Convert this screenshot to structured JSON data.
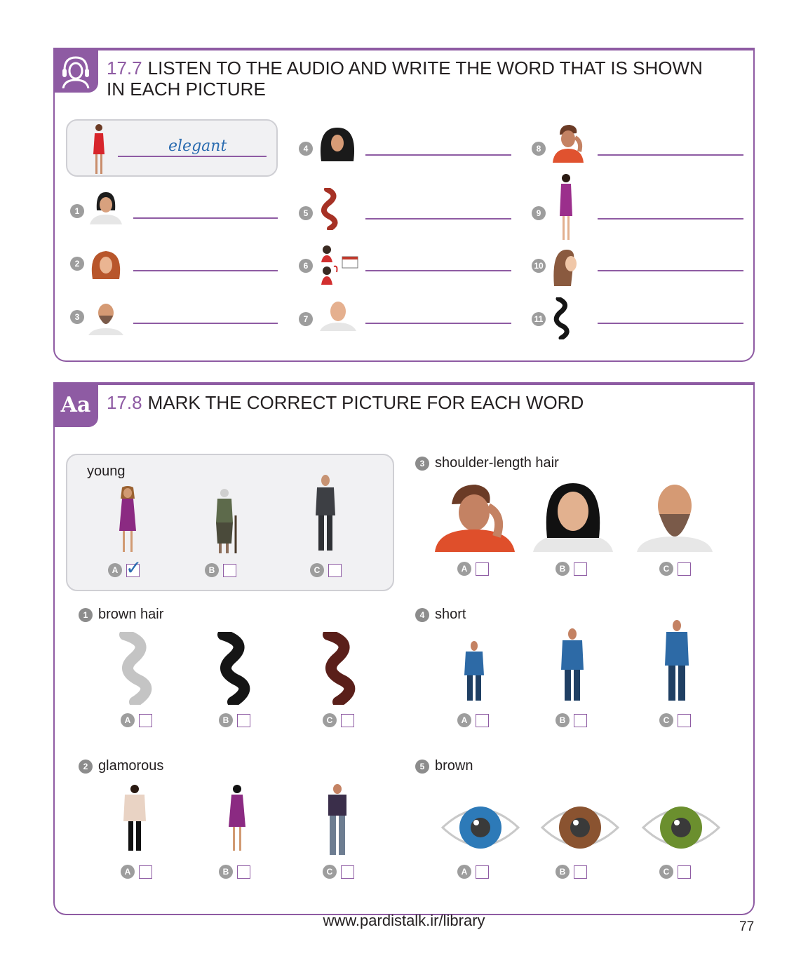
{
  "ex77": {
    "number": "17.7",
    "title_line1": "LISTEN TO THE AUDIO AND WRITE THE WORD THAT IS SHOWN",
    "title_line2": "IN EACH PICTURE",
    "icon": "headphones-person-icon",
    "example_answer": "elegant",
    "items": [
      {
        "n": "1",
        "image": "woman-short-black-bob"
      },
      {
        "n": "2",
        "image": "woman-curly-red-hair"
      },
      {
        "n": "3",
        "image": "bald-man-with-beard"
      },
      {
        "n": "4",
        "image": "woman-curly-black-hair"
      },
      {
        "n": "5",
        "image": "red-wavy-hair-lock"
      },
      {
        "n": "6",
        "image": "woman-getting-older-calendar"
      },
      {
        "n": "7",
        "image": "bald-man"
      },
      {
        "n": "8",
        "image": "man-scratching-head"
      },
      {
        "n": "9",
        "image": "woman-purple-dress"
      },
      {
        "n": "10",
        "image": "woman-long-straight-hair-profile"
      },
      {
        "n": "11",
        "image": "black-wavy-hair-lock"
      }
    ]
  },
  "ex78": {
    "number": "17.8",
    "title": "MARK THE CORRECT PICTURE FOR EACH WORD",
    "tab_label": "Aa",
    "example": {
      "word": "young",
      "options": [
        "A",
        "B",
        "C"
      ],
      "checked": "A",
      "check_mark": "✓"
    },
    "questions": [
      {
        "n": "1",
        "word": "brown hair",
        "options": [
          "A",
          "B",
          "C"
        ]
      },
      {
        "n": "2",
        "word": "glamorous",
        "options": [
          "A",
          "B",
          "C"
        ]
      },
      {
        "n": "3",
        "word": "shoulder-length hair",
        "options": [
          "A",
          "B",
          "C"
        ]
      },
      {
        "n": "4",
        "word": "short",
        "options": [
          "A",
          "B",
          "C"
        ]
      },
      {
        "n": "5",
        "word": "brown",
        "options": [
          "A",
          "B",
          "C"
        ]
      }
    ]
  },
  "colors": {
    "accent": "#8e5ba3",
    "answer": "#2b6cb0"
  },
  "footer": {
    "url": "www.pardistalk.ir/library",
    "page": "77"
  }
}
